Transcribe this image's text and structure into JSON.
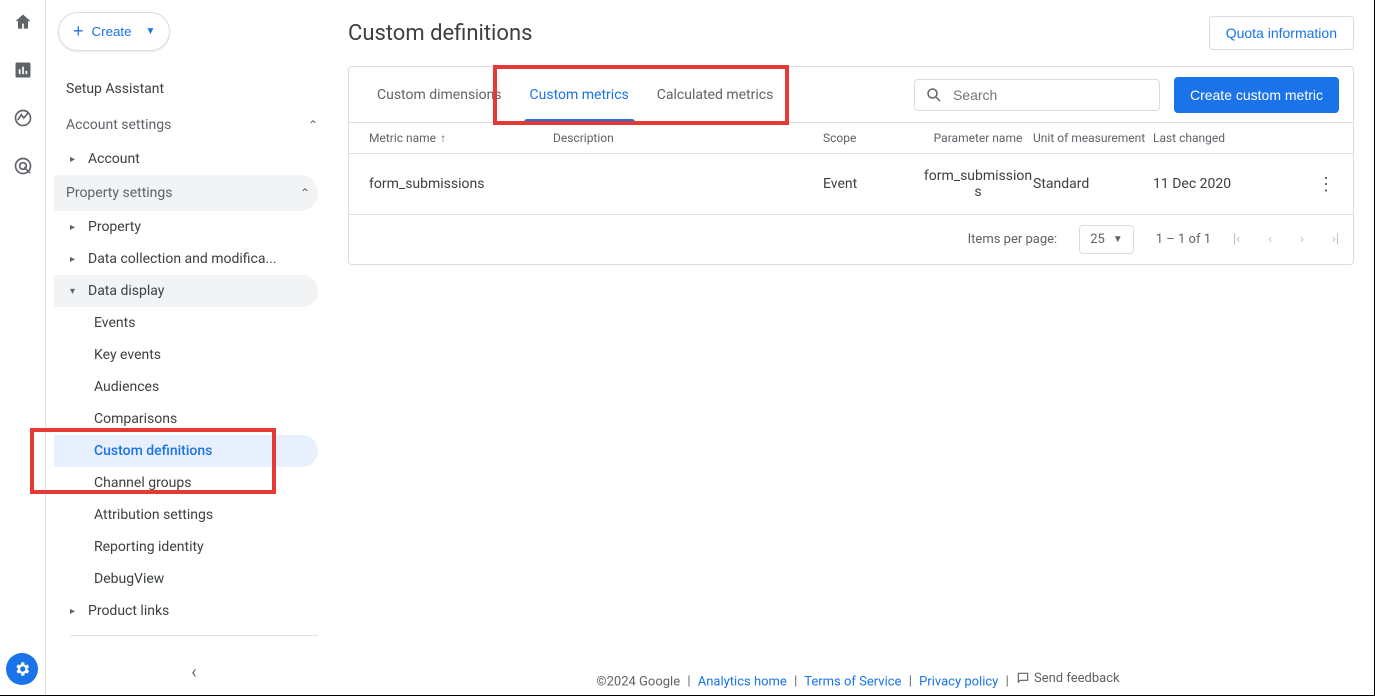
{
  "create_button": {
    "label": "Create"
  },
  "sidebar": {
    "setup_assistant": "Setup Assistant",
    "account_settings": "Account settings",
    "account": "Account",
    "property_settings": "Property settings",
    "property": "Property",
    "data_collection": "Data collection and modifica...",
    "data_display": "Data display",
    "leaves": {
      "events": "Events",
      "key_events": "Key events",
      "audiences": "Audiences",
      "comparisons": "Comparisons",
      "custom_definitions": "Custom definitions",
      "channel_groups": "Channel groups",
      "attribution_settings": "Attribution settings",
      "reporting_identity": "Reporting identity",
      "debugview": "DebugView"
    },
    "product_links": "Product links"
  },
  "page": {
    "title": "Custom definitions",
    "quota_button": "Quota information",
    "tabs": {
      "dimensions": "Custom dimensions",
      "metrics": "Custom metrics",
      "calculated": "Calculated metrics"
    },
    "search_placeholder": "Search",
    "create_metric_button": "Create custom metric"
  },
  "table": {
    "headers": {
      "name": "Metric name",
      "description": "Description",
      "scope": "Scope",
      "parameter": "Parameter name",
      "unit": "Unit of measurement",
      "last_changed": "Last changed"
    },
    "rows": [
      {
        "name": "form_submissions",
        "description": "",
        "scope": "Event",
        "parameter": "form_submissions",
        "unit": "Standard",
        "last_changed": "11 Dec 2020"
      }
    ]
  },
  "pager": {
    "items_per_page_label": "Items per page:",
    "items_per_page_value": "25",
    "range": "1 – 1 of 1"
  },
  "footer": {
    "copyright": "©2024 Google",
    "analytics_home": "Analytics home",
    "terms": "Terms of Service",
    "privacy": "Privacy policy",
    "feedback": "Send feedback"
  }
}
